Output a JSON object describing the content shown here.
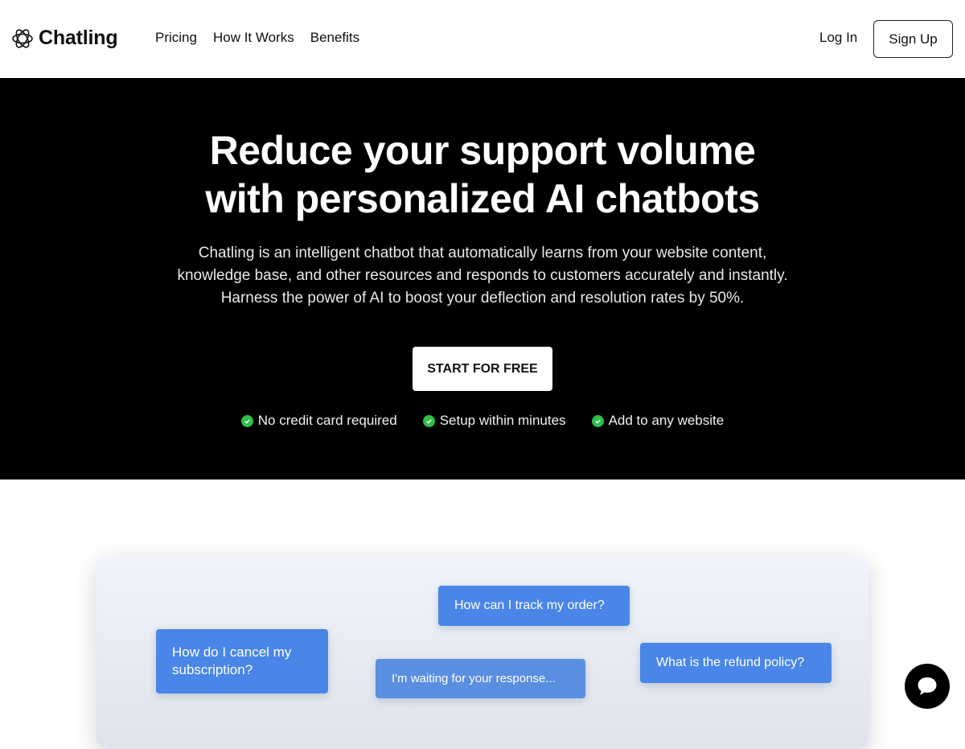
{
  "nav": {
    "brand": "Chatling",
    "links": [
      {
        "label": "Pricing"
      },
      {
        "label": "How It Works"
      },
      {
        "label": "Benefits"
      }
    ],
    "login_label": "Log In",
    "signup_label": "Sign Up"
  },
  "hero": {
    "title_line1": "Reduce your support volume",
    "title_line2": "with personalized AI chatbots",
    "subtitle": "Chatling is an intelligent chatbot that automatically learns from your website content, knowledge base, and other resources and responds to customers accurately and instantly. Harness the power of AI to boost your deflection and resolution rates by 50%.",
    "cta_label": "START FOR FREE",
    "checks": [
      {
        "label": "No credit card required",
        "icon": "check-circle-icon"
      },
      {
        "label": "Setup within minutes",
        "icon": "check-circle-icon"
      },
      {
        "label": "Add to any website",
        "icon": "check-circle-icon"
      }
    ]
  },
  "demo": {
    "bubbles": [
      {
        "text": "How can I track my order?"
      },
      {
        "text": "How do I cancel my subscription?"
      },
      {
        "text": "I'm waiting for your response..."
      },
      {
        "text": "What is the refund policy?"
      }
    ]
  },
  "chat_widget": {
    "icon": "chat-bubble-icon"
  },
  "colors": {
    "hero_bg": "#000000",
    "bubble": "#4a86e8",
    "check": "#2fbf4a"
  }
}
